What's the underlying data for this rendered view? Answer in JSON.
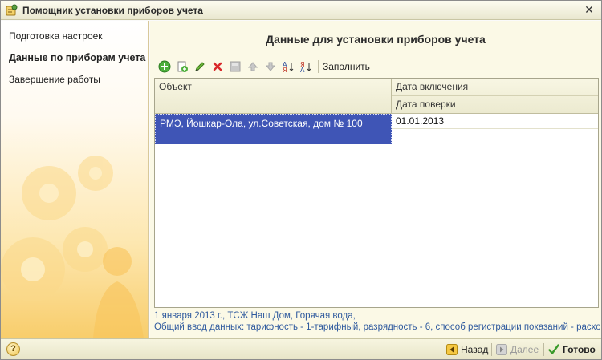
{
  "window": {
    "title": "Помощник установки приборов учета"
  },
  "sidebar": {
    "steps": [
      {
        "label": "Подготовка настроек",
        "active": false
      },
      {
        "label": "Данные по приборам учета",
        "active": true
      },
      {
        "label": "Завершение работы",
        "active": false
      }
    ]
  },
  "main": {
    "title": "Данные для установки приборов учета",
    "toolbar": {
      "icons": [
        "add-icon",
        "copy-icon",
        "edit-icon",
        "delete-icon",
        "save-icon",
        "move-up-icon",
        "move-down-icon",
        "sort-ascending-icon",
        "sort-descending-icon"
      ],
      "fill_label": "Заполнить"
    },
    "table": {
      "columns": {
        "object": "Объект",
        "date_on": "Дата включения",
        "date_check": "Дата поверки"
      },
      "rows": [
        {
          "object": "РМЭ, Йошкар-Ола, ул.Советская, дом № 100",
          "date_on": "01.01.2013",
          "date_check": ""
        }
      ]
    },
    "info": {
      "line1": "1 января 2013 г., ТСЖ Наш Дом, Горячая вода,",
      "line2": "Общий ввод данных: тарифность - 1-тарифный, разрядность - 6, способ регистрации показаний - расход за"
    }
  },
  "footer": {
    "help_label": "?",
    "back_label": "Назад",
    "next_label": "Далее",
    "done_label": "Готово"
  },
  "colors": {
    "selection": "#3f55b6",
    "info_text": "#2f5a9e",
    "sidebar_gradient_end": "#f8cd6b"
  }
}
